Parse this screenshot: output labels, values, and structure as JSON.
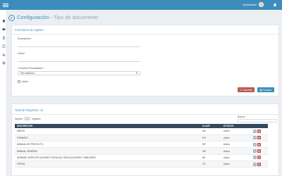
{
  "topbar": {
    "user_name": "Administrador"
  },
  "page": {
    "title": "Configuración",
    "separator": " - ",
    "subtitle": "Tipo de documento"
  },
  "form": {
    "heading": "Formulario de registro",
    "descripcion_label": "Descripción",
    "descripcion_value": "",
    "clave_label": "Clave*",
    "clave_value": "",
    "convenio_label": "Convenio Fiscalizador*",
    "convenio_selected": "Tres entornos",
    "activo_label": "Activo",
    "activo_checked": true,
    "cancel_label": "Cancelar",
    "save_label": "Guardar"
  },
  "list": {
    "total_label": "Total de Registros: 13",
    "show_prefix": "Mostrar",
    "show_count": "10",
    "show_suffix": "registros",
    "search_label": "Buscar:",
    "columns": [
      "DESCRIPCIÓN",
      "CLAVE",
      "ESTATUS",
      ""
    ],
    "rows": [
      {
        "descripcion": "ANEXO",
        "clave": "AN",
        "estatus": "Activo"
      },
      {
        "descripcion": "FORMATO",
        "clave": "FM",
        "estatus": "Activo"
      },
      {
        "descripcion": "MANUAL DE PROYECTO",
        "clave": "MP",
        "estatus": "Activo"
      },
      {
        "descripcion": "MANUAL GENERAL",
        "clave": "MG",
        "estatus": "Activo"
      },
      {
        "descripcion": "NORMAS, ESPECIFICACIONES TÉCNICAS, REGULACIONES Y SIMILARES",
        "clave": "NE",
        "estatus": "Activo"
      },
      {
        "descripcion": "OTROS",
        "clave": "OT",
        "estatus": "Activo"
      }
    ]
  },
  "colors": {
    "primary": "#3c8dbc",
    "danger": "#b75b4b",
    "table_header": "#34495e",
    "background": "#eceff2"
  },
  "icons": [
    "menu-icon",
    "user-avatar",
    "bell-icon",
    "back-arrow-icon",
    "edit-icon",
    "delete-icon",
    "check-icon",
    "chevron-down-icon",
    "save-icon",
    "cancel-icon"
  ]
}
